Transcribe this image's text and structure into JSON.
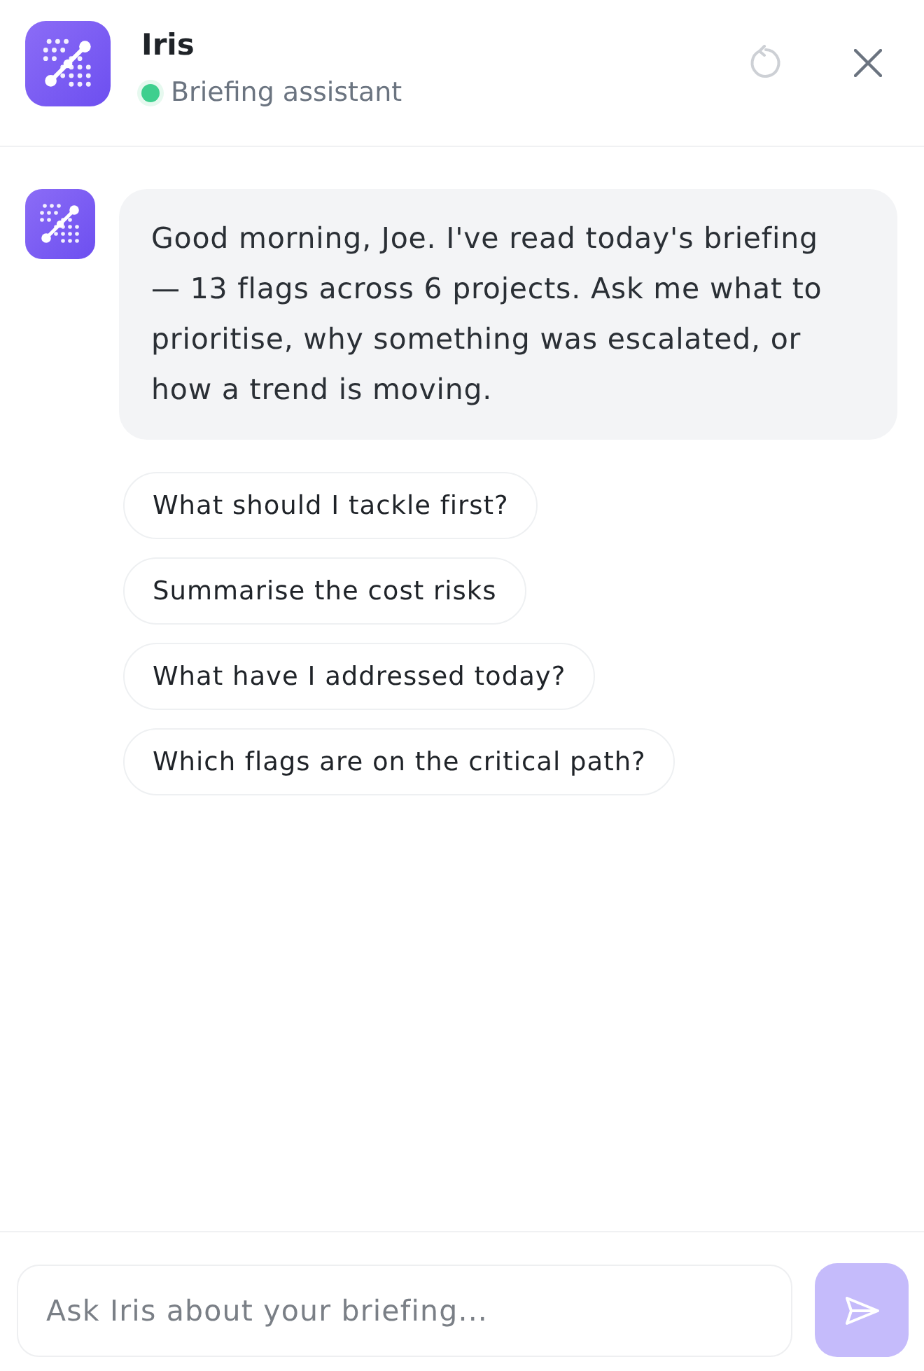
{
  "header": {
    "title": "Iris",
    "status": {
      "text": "Briefing assistant",
      "online": true
    },
    "refresh": {
      "disabled": true
    }
  },
  "messages": [
    {
      "kind": "assistant",
      "text": "Good morning, Joe. I've read today's briefing — 13 flags across 6 projects. Ask me what to prioritise, why something was escalated, or how a trend is moving."
    }
  ],
  "suggestions": [
    {
      "label": "What should I tackle first?"
    },
    {
      "label": "Summarise the cost risks"
    },
    {
      "label": "What have I addressed today?"
    },
    {
      "label": "Which flags are on the critical path?"
    }
  ],
  "composer": {
    "placeholder": "Ask Iris about your briefing...",
    "send_disabled": true
  }
}
